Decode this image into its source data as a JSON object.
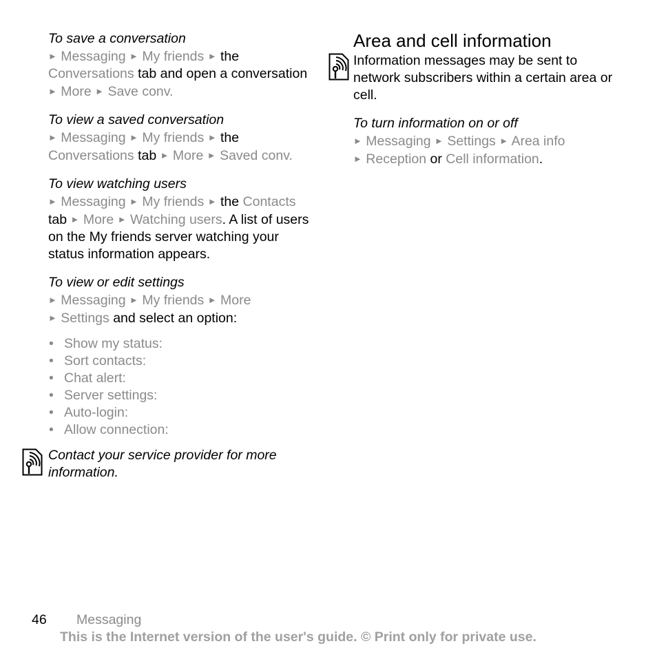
{
  "left_column": {
    "save_conversation": {
      "heading": "To save a conversation",
      "steps": [
        "Messaging",
        "My friends",
        "the",
        "Conversations",
        "tab and open a conversation",
        "More",
        "Save conv."
      ]
    },
    "view_saved": {
      "heading": "To view a saved conversation",
      "steps": [
        "Messaging",
        "My friends",
        "the",
        "Conversations",
        "tab",
        "More",
        "Saved conv."
      ]
    },
    "view_watching": {
      "heading": "To view watching users",
      "steps": [
        "Messaging",
        "My friends",
        "the",
        "Contacts",
        "tab",
        "More",
        "Watching users",
        ". A list of users on the My friends server watching your status information appears."
      ]
    },
    "edit_settings": {
      "heading": "To view or edit settings",
      "steps": [
        "Messaging",
        "My friends",
        "More",
        "Settings",
        "and select an option:"
      ],
      "options": [
        "Show my status:",
        "Sort contacts:",
        "Chat alert:",
        "Server settings:",
        "Auto-login:",
        "Allow connection:"
      ]
    },
    "note": {
      "icon": "operator-service-icon",
      "text": "Contact your service provider for more information."
    }
  },
  "right_column": {
    "title": "Area and cell information",
    "intro": "Information messages may be sent to network subscribers within a certain area or cell.",
    "intro_icon": "operator-service-icon",
    "turn_on_off": {
      "heading": "To turn information on or off",
      "steps": [
        "Messaging",
        "Settings",
        "Area info",
        "Reception",
        "or",
        "Cell information",
        "."
      ]
    }
  },
  "footer": {
    "page_number": "46",
    "section": "Messaging",
    "disclaimer": "This is the Internet version of the user's guide. © Print only for private use."
  },
  "colors": {
    "text": "#000000",
    "menu_path": "#8a8a8a",
    "disclaimer": "#a0a0a0"
  }
}
